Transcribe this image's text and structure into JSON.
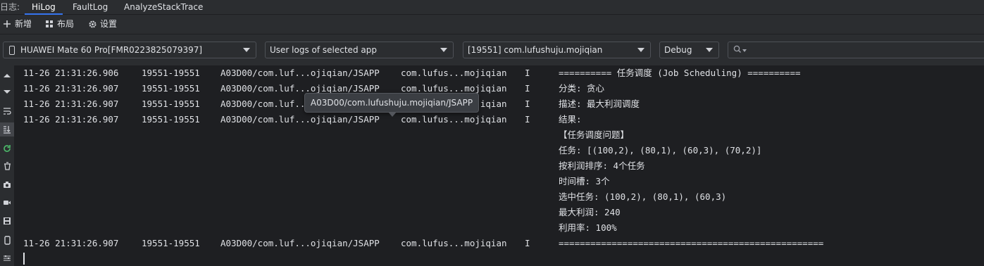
{
  "tabs": {
    "prefix": "日志:",
    "items": [
      {
        "label": "HiLog",
        "active": true
      },
      {
        "label": "FaultLog",
        "active": false
      },
      {
        "label": "AnalyzeStackTrace",
        "active": false
      }
    ]
  },
  "actions": {
    "add": "新增",
    "layout": "布局",
    "settings": "设置"
  },
  "filters": {
    "device": "HUAWEI Mate 60 Pro[FMR0223825079397]",
    "scope": "User logs of selected app",
    "process": "[19551] com.lufushuju.mojiqian",
    "level": "Debug",
    "search_placeholder": ""
  },
  "log": {
    "rows": [
      {
        "time": "11-26 21:31:26.906",
        "pid": "19551-19551",
        "tag": "A03D00/com.luf...ojiqian/JSAPP",
        "pkg": "com.lufus...mojiqian",
        "lvl": "I",
        "msg": "========== 任务调度 (Job Scheduling) =========="
      },
      {
        "time": "11-26 21:31:26.907",
        "pid": "19551-19551",
        "tag": "A03D00/com.luf...ojiqian/JSAPP",
        "pkg": "com.lufus...mojiqian",
        "lvl": "I",
        "msg": "分类: 贪心"
      },
      {
        "time": "11-26 21:31:26.907",
        "pid": "19551-19551",
        "tag": "A03D00/com.luf...ojiqian/JSAPP",
        "pkg": "com.lufus...mojiqian",
        "lvl": "I",
        "msg": "描述: 最大利润调度"
      },
      {
        "time": "11-26 21:31:26.907",
        "pid": "19551-19551",
        "tag": "A03D00/com.luf...ojiqian/JSAPP",
        "pkg": "com.lufus...mojiqian",
        "lvl": "I",
        "msg": "结果:"
      },
      {
        "time": "",
        "pid": "",
        "tag": "",
        "pkg": "",
        "lvl": "",
        "msg": "【任务调度问题】"
      },
      {
        "time": "",
        "pid": "",
        "tag": "",
        "pkg": "",
        "lvl": "",
        "msg": "任务: [(100,2), (80,1), (60,3), (70,2)]"
      },
      {
        "time": "",
        "pid": "",
        "tag": "",
        "pkg": "",
        "lvl": "",
        "msg": "按利润排序: 4个任务"
      },
      {
        "time": "",
        "pid": "",
        "tag": "",
        "pkg": "",
        "lvl": "",
        "msg": "时间槽: 3个"
      },
      {
        "time": "",
        "pid": "",
        "tag": "",
        "pkg": "",
        "lvl": "",
        "msg": "选中任务: (100,2), (80,1), (60,3)"
      },
      {
        "time": "",
        "pid": "",
        "tag": "",
        "pkg": "",
        "lvl": "",
        "msg": "最大利润: 240"
      },
      {
        "time": "",
        "pid": "",
        "tag": "",
        "pkg": "",
        "lvl": "",
        "msg": "利用率: 100%"
      },
      {
        "time": "11-26 21:31:26.907",
        "pid": "19551-19551",
        "tag": "A03D00/com.luf...ojiqian/JSAPP",
        "pkg": "com.lufus...mojiqian",
        "lvl": "I",
        "msg": "=================================================="
      }
    ]
  },
  "tooltip": {
    "text": "A03D00/com.lufushuju.mojiqian/JSAPP"
  },
  "sidebar_icons": [
    "arrow-up-icon",
    "arrow-down-icon",
    "soft-wrap-icon",
    "scroll-to-end-icon",
    "restart-icon",
    "trash-icon",
    "camera-icon",
    "video-icon",
    "save-icon",
    "device-icon",
    "filter-settings-icon"
  ]
}
